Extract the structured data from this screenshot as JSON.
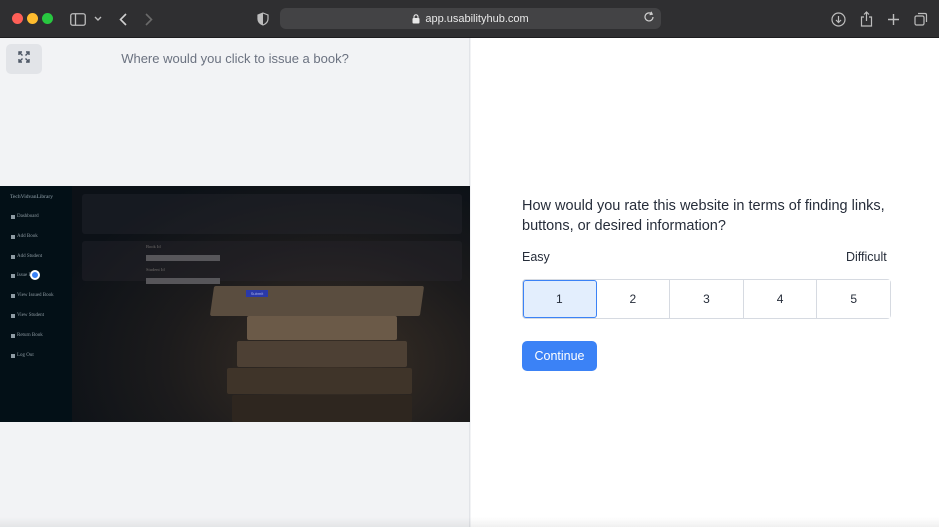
{
  "browser": {
    "url": "app.usabilityhub.com"
  },
  "left": {
    "question": "Where would you click to issue a book?",
    "screenshot": {
      "brand": "TechVidvanLibrary",
      "sidebar_items": [
        "Dashboard",
        "Add Book",
        "Add Student",
        "Issue Book",
        "View Issued Book",
        "View Student",
        "Return Book",
        "Log Out"
      ],
      "form_labels": [
        "Book Id",
        "Student Id"
      ],
      "submit_label": "Submit"
    }
  },
  "right": {
    "question": "How would you rate this website in terms of finding links, buttons, or desired information?",
    "scale_low": "Easy",
    "scale_high": "Difficult",
    "options": [
      "1",
      "2",
      "3",
      "4",
      "5"
    ],
    "selected": "1",
    "continue_label": "Continue"
  },
  "colors": {
    "accent": "#3b82f6",
    "selected_bg": "#e3eefd"
  }
}
